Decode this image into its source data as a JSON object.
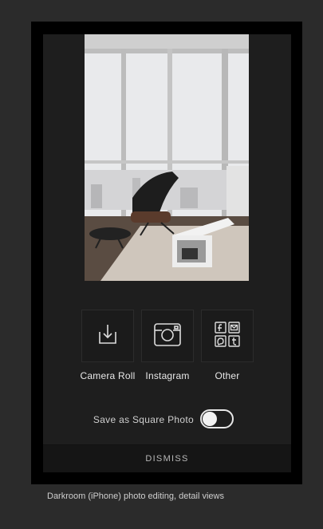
{
  "share": {
    "items": [
      {
        "label": "Camera Roll",
        "icon": "download-tray-icon"
      },
      {
        "label": "Instagram",
        "icon": "instagram-camera-icon"
      },
      {
        "label": "Other",
        "icon": "social-grid-icon"
      }
    ]
  },
  "options": {
    "square_label": "Save as Square Photo",
    "square_enabled": false
  },
  "dismiss_label": "DISMISS",
  "caption": "Darkroom (iPhone) photo editing, detail views"
}
